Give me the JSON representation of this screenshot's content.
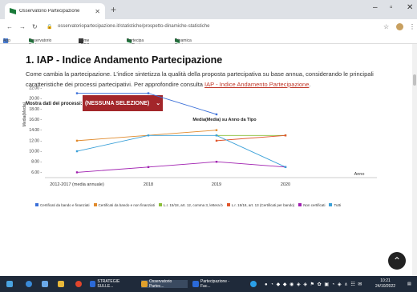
{
  "browser": {
    "tab_title": "Osservatorio Partecipazione",
    "url": "osservatoriopartecipazione.it/statistiche/prospetto-dinamiche-statistiche",
    "bookmarks": [
      "App",
      "Osservatorio Partec...",
      "Home - BBC News",
      "Partecipa — Regi...",
      "Dinamica Regione Em..."
    ]
  },
  "page": {
    "title": "1. IAP - Indice Andamento Partecipazione",
    "desc1": "Come cambia la partecipazione. L'indice sintetizza la qualità della proposta partecipativa su base annua, considerando le principali",
    "desc2": "caratteristiche dei processi partecipativi. Per approfondire consulta ",
    "desc_link": "IAP - Indice Andamento Partecipazione",
    "filter_label": "Mostra dati dei processi:",
    "filter_value": "(NESSUNA SELEZIONE)"
  },
  "chart_data": {
    "type": "line",
    "title": "Media(Media) su Anno da Tipo",
    "xlabel": "Anno",
    "ylabel": "Media(Media)",
    "categories": [
      "2012-2017 (media annuale)",
      "2018",
      "2019",
      "2020"
    ],
    "ylim": [
      5,
      22
    ],
    "yticks": [
      "22.00",
      "20.00",
      "18.00",
      "16.00",
      "14.00",
      "12.00",
      "10.00",
      "8.00",
      "6.00"
    ],
    "series": [
      {
        "name": "Certificati da bando e finanziati",
        "color": "#3a6fd8",
        "values": [
          21,
          21,
          17,
          null
        ]
      },
      {
        "name": "Certificati da bando e non finanziati",
        "color": "#e08a2c",
        "values": [
          12,
          null,
          14,
          null
        ]
      },
      {
        "name": "L.r. 15/18, art. 12, comma 3, lettera b",
        "color": "#8bbf3a",
        "values": [
          null,
          null,
          13,
          13
        ]
      },
      {
        "name": "L.r. 15/18, art. 13 (Certificati per bando)",
        "color": "#e0562c",
        "values": [
          null,
          null,
          12,
          13
        ]
      },
      {
        "name": "Non certificati",
        "color": "#a020b0",
        "values": [
          6,
          7,
          8,
          7
        ]
      },
      {
        "name": "Tutti",
        "color": "#3aa0d8",
        "values": [
          10,
          13,
          13,
          7
        ]
      }
    ]
  },
  "taskbar": {
    "apps": [
      "STRATEGIE SULLE...",
      "Osservatorio Partec...",
      "Partecipazione - Fac..."
    ],
    "time": "10:21",
    "date": "24/10/2022"
  }
}
